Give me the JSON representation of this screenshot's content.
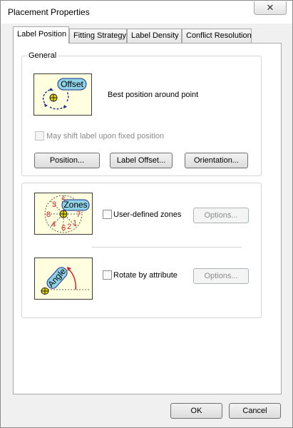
{
  "window": {
    "title": "Placement Properties",
    "close_glyph": "✕"
  },
  "tabs": [
    {
      "label": "Label Position",
      "active": true
    },
    {
      "label": "Fitting Strategy",
      "active": false
    },
    {
      "label": "Label Density",
      "active": false
    },
    {
      "label": "Conflict Resolution",
      "active": false
    }
  ],
  "general": {
    "group_label": "General",
    "illustration_text": "Offset",
    "description": "Best position around point",
    "shift_label": "May shift label upon fixed position",
    "buttons": {
      "position": "Position...",
      "label_offset": "Label Offset...",
      "orientation": "Orientation..."
    }
  },
  "zones": {
    "illustration_text": "Zones",
    "zone_numbers": [
      "3",
      "5",
      "7",
      "8",
      "1",
      "4",
      "6",
      "2"
    ],
    "checkbox_label": "User-defined zones",
    "options_label": "Options..."
  },
  "rotate": {
    "illustration_text": "Angle",
    "checkbox_label": "Rotate by attribute",
    "options_label": "Options..."
  },
  "footer": {
    "ok_label": "OK",
    "cancel_label": "Cancel"
  },
  "colors": {
    "thumb_bg": "#ffffe0",
    "label_bubble": "#8fd3e8",
    "arrow": "#1c2c8c",
    "zone_digit": "#e02020",
    "point": "#e8d800"
  }
}
